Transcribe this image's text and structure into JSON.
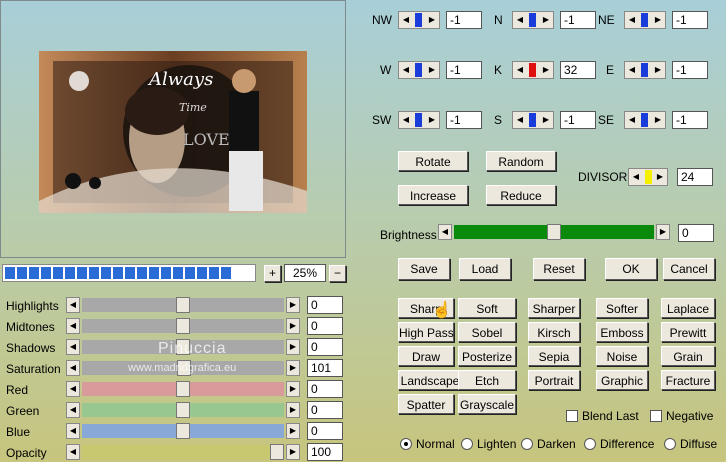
{
  "preview": {
    "art_text_1": "Always",
    "art_text_2": "Time",
    "art_text_3": "LOVE"
  },
  "zoom": {
    "plus": "+",
    "minus": "−",
    "value": "25%"
  },
  "kernel": [
    {
      "id": "nw",
      "label": "NW",
      "value": "-1",
      "color": "#1a3cd8"
    },
    {
      "id": "n",
      "label": "N",
      "value": "-1",
      "color": "#1a3cd8"
    },
    {
      "id": "ne",
      "label": "NE",
      "value": "-1",
      "color": "#1a3cd8"
    },
    {
      "id": "w",
      "label": "W",
      "value": "-1",
      "color": "#1a3cd8"
    },
    {
      "id": "k",
      "label": "K",
      "value": "32",
      "color": "#e01010"
    },
    {
      "id": "e",
      "label": "E",
      "value": "-1",
      "color": "#1a3cd8"
    },
    {
      "id": "sw",
      "label": "SW",
      "value": "-1",
      "color": "#1a3cd8"
    },
    {
      "id": "s",
      "label": "S",
      "value": "-1",
      "color": "#1a3cd8"
    },
    {
      "id": "se",
      "label": "SE",
      "value": "-1",
      "color": "#1a3cd8"
    }
  ],
  "actions": {
    "rotate": "Rotate",
    "random": "Random",
    "increase": "Increase",
    "reduce": "Reduce"
  },
  "divisor": {
    "label": "DIVISOR",
    "value": "24"
  },
  "brightness": {
    "label": "Brightness",
    "value": "0",
    "level": 0.5
  },
  "main_buttons": {
    "save": "Save",
    "load": "Load",
    "reset": "Reset",
    "ok": "OK",
    "cancel": "Cancel"
  },
  "adjust": [
    {
      "id": "highlights",
      "label": "Highlights",
      "value": "0",
      "level": 0.5,
      "color": "#a8a8a8"
    },
    {
      "id": "midtones",
      "label": "Midtones",
      "value": "0",
      "level": 0.5,
      "color": "#a8a8a8"
    },
    {
      "id": "shadows",
      "label": "Shadows",
      "value": "0",
      "level": 0.5,
      "color": "#a8a8a8"
    },
    {
      "id": "saturation",
      "label": "Saturation",
      "value": "101",
      "level": 0.505,
      "color": "#a8a8a8"
    },
    {
      "id": "red",
      "label": "Red",
      "value": "0",
      "level": 0.5,
      "color": "#d89a9a"
    },
    {
      "id": "green",
      "label": "Green",
      "value": "0",
      "level": 0.5,
      "color": "#98c890"
    },
    {
      "id": "blue",
      "label": "Blue",
      "value": "0",
      "level": 0.5,
      "color": "#88a8d8"
    },
    {
      "id": "opacity",
      "label": "Opacity",
      "value": "100",
      "level": 1.0,
      "color": "#c8c870"
    }
  ],
  "presets": [
    [
      "Sharp",
      "Soft",
      "Sharper",
      "Softer",
      "Laplace"
    ],
    [
      "High Pass",
      "Sobel",
      "Kirsch",
      "Emboss",
      "Prewitt"
    ],
    [
      "Draw",
      "Posterize",
      "Sepia",
      "Noise",
      "Grain"
    ],
    [
      "Landscape",
      "Etch",
      "Portrait",
      "Graphic",
      "Fracture"
    ],
    [
      "Spatter",
      "Grayscale"
    ]
  ],
  "options": {
    "blend_last": "Blend Last",
    "negative": "Negative"
  },
  "blend_modes": [
    {
      "label": "Normal",
      "selected": true
    },
    {
      "label": "Lighten",
      "selected": false
    },
    {
      "label": "Darken",
      "selected": false
    },
    {
      "label": "Difference",
      "selected": false
    },
    {
      "label": "Diffuse",
      "selected": false
    }
  ],
  "watermark": {
    "name": "Pinuccia",
    "site": "www.madridgrafica.eu"
  },
  "colors": {
    "progress": "#2a6bd6",
    "brightness_track": "#0a8a0a",
    "divisor_thumb": "#f4f000"
  }
}
